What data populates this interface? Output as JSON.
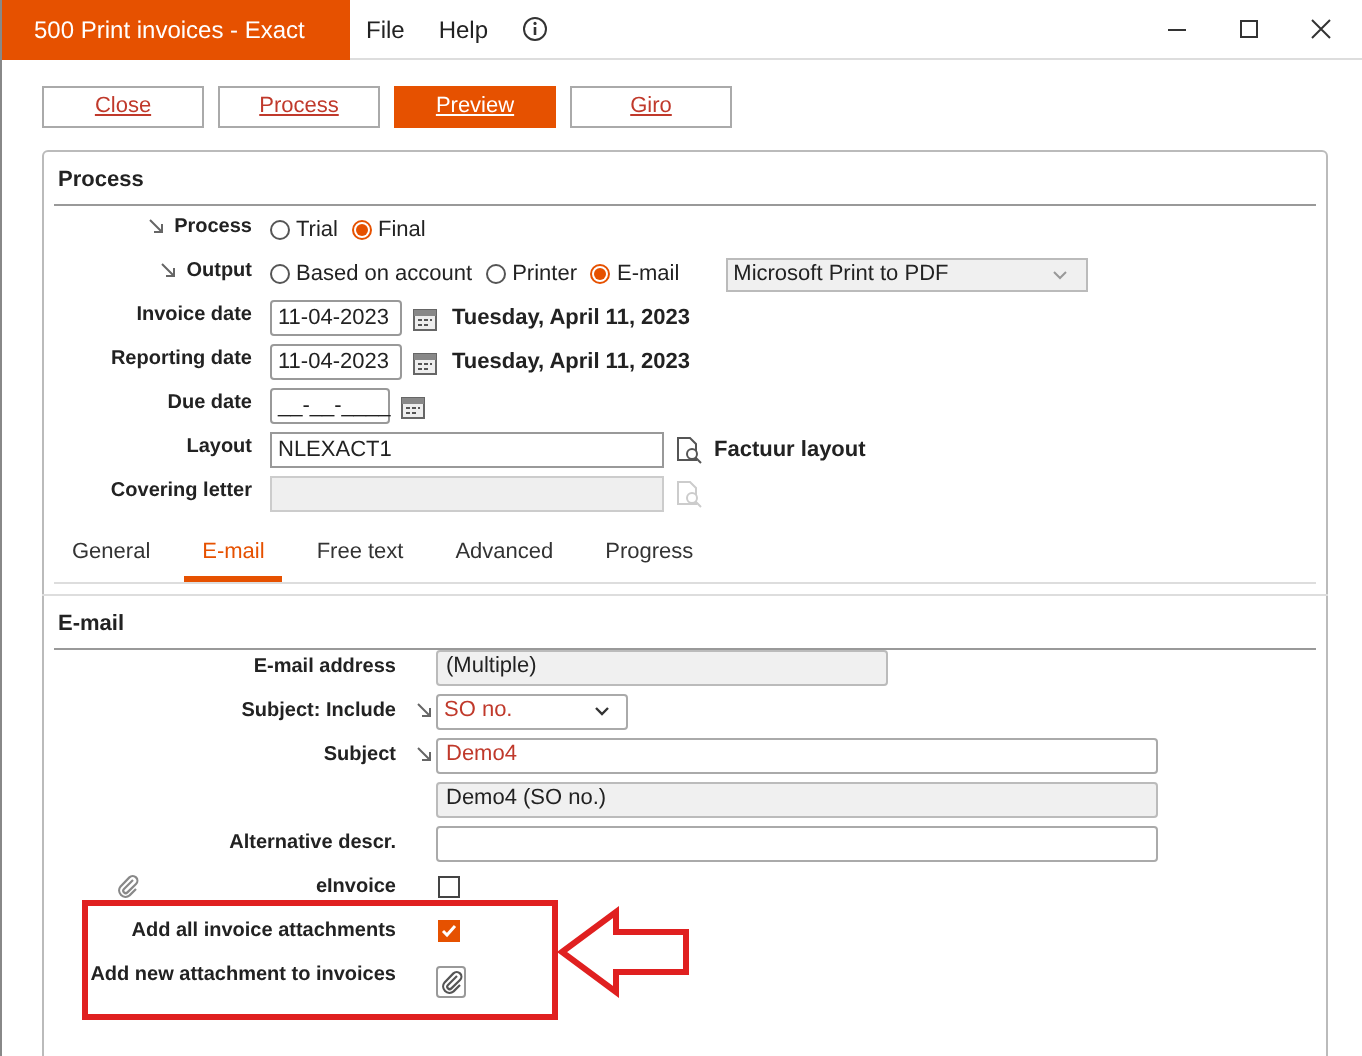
{
  "window": {
    "title": "500 Print invoices - Exact",
    "menu": [
      "File",
      "Help"
    ]
  },
  "buttons": [
    {
      "label": "Close",
      "primary": false
    },
    {
      "label": "Process",
      "primary": false
    },
    {
      "label": "Preview",
      "primary": true
    },
    {
      "label": "Giro",
      "primary": false
    }
  ],
  "process": {
    "title": "Process",
    "rows": [
      {
        "kind": "radio",
        "label": "Process",
        "pinned": true,
        "options": [
          {
            "label": "Trial",
            "selected": false
          },
          {
            "label": "Final",
            "selected": true
          }
        ]
      },
      {
        "kind": "radio",
        "label": "Output",
        "pinned": true,
        "options": [
          {
            "label": "Based on account",
            "selected": false
          },
          {
            "label": "Printer",
            "selected": false
          },
          {
            "label": "E-mail",
            "selected": true
          }
        ],
        "printer": "Microsoft Print to PDF"
      },
      {
        "kind": "date",
        "label": "Invoice date",
        "value": "11-04-2023",
        "description": "Tuesday, April 11, 2023"
      },
      {
        "kind": "date",
        "label": "Reporting date",
        "value": "11-04-2023",
        "description": "Tuesday, April 11, 2023"
      },
      {
        "kind": "date",
        "label": "Due date",
        "value": "__-__-____"
      },
      {
        "kind": "lookup",
        "label": "Layout",
        "value": "NLEXACT1",
        "description": "Factuur layout",
        "disabled": false
      },
      {
        "kind": "lookup",
        "label": "Covering letter",
        "disabled": true
      }
    ]
  },
  "tabs": [
    {
      "label": "General",
      "selected": false
    },
    {
      "label": "E-mail",
      "selected": true
    },
    {
      "label": "Free text",
      "selected": false
    },
    {
      "label": "Advanced",
      "selected": false
    },
    {
      "label": "Progress",
      "selected": false
    }
  ],
  "email": {
    "title": "E-mail",
    "rows": [
      {
        "kind": "short",
        "label": "E-mail address",
        "value": "(Multiple)",
        "readonly": true
      },
      {
        "kind": "select",
        "label": "Subject: Include",
        "pinned": true,
        "value": "SO no.",
        "modified": true
      },
      {
        "kind": "text",
        "label": "Subject",
        "pinned": true,
        "value": "Demo4",
        "modified": true
      },
      {
        "kind": "text",
        "value": "Demo4 (SO no.)",
        "readonly": true
      },
      {
        "kind": "text",
        "label": "Alternative descr."
      },
      {
        "kind": "checkbox",
        "label": "eInvoice",
        "checked": false,
        "attachment_icon": true
      },
      {
        "kind": "checkbox",
        "label": "Add all invoice attachments",
        "checked": true
      },
      {
        "kind": "attach",
        "label": "Add new attachment to invoices"
      }
    ]
  }
}
